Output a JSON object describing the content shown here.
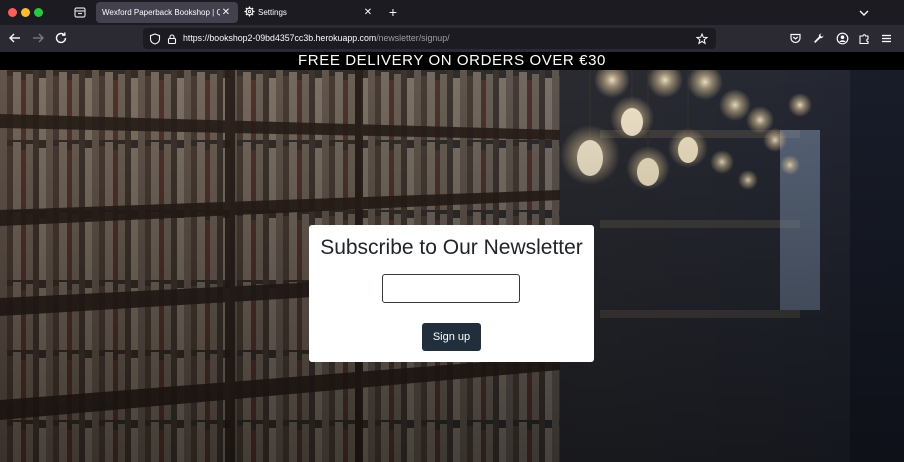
{
  "browser": {
    "tabs": [
      {
        "title": "Wexford Paperback Bookshop | Qua",
        "active": true
      },
      {
        "title": "Settings",
        "active": false
      }
    ],
    "new_tab_label": "+",
    "close_glyph": "✕",
    "url": {
      "host": "https://bookshop2-09bd4357cc3b.herokuapp.com",
      "path": "/newsletter/signup/"
    },
    "colors": {
      "chrome_bg": "#1c1b22",
      "toolbar_bg": "#2b2a33",
      "active_tab": "#42414d"
    }
  },
  "page": {
    "banner_text": "FREE DELIVERY ON ORDERS OVER €30",
    "newsletter": {
      "title": "Subscribe to Our Newsletter",
      "email_value": "",
      "email_placeholder": "",
      "button_label": "Sign up"
    },
    "colors": {
      "banner_bg": "#000000",
      "button_bg": "#212f3d",
      "card_bg": "#ffffff"
    }
  }
}
